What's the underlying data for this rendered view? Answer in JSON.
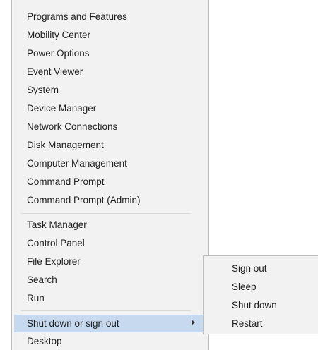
{
  "menu": {
    "items": [
      {
        "label": "Programs and Features"
      },
      {
        "label": "Mobility Center"
      },
      {
        "label": "Power Options"
      },
      {
        "label": "Event Viewer"
      },
      {
        "label": "System"
      },
      {
        "label": "Device Manager"
      },
      {
        "label": "Network Connections"
      },
      {
        "label": "Disk Management"
      },
      {
        "label": "Computer Management"
      },
      {
        "label": "Command Prompt"
      },
      {
        "label": "Command Prompt (Admin)"
      },
      {
        "label": "Task Manager"
      },
      {
        "label": "Control Panel"
      },
      {
        "label": "File Explorer"
      },
      {
        "label": "Search"
      },
      {
        "label": "Run"
      },
      {
        "label": "Shut down or sign out"
      },
      {
        "label": "Desktop"
      }
    ]
  },
  "submenu": {
    "items": [
      {
        "label": "Sign out"
      },
      {
        "label": "Sleep"
      },
      {
        "label": "Shut down"
      },
      {
        "label": "Restart"
      }
    ]
  },
  "colors": {
    "menu_background": "#f2f2f2",
    "highlight": "#c7d9ee",
    "text": "#1f1f1f"
  }
}
